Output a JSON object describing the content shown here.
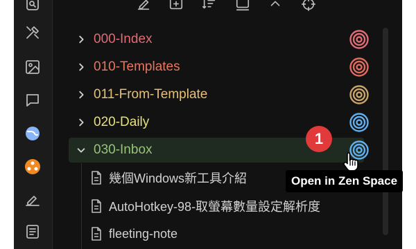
{
  "colors": {
    "index": "#e06c75",
    "templates": "#e8765f",
    "from_template": "#e5c07b",
    "daily": "#e6e17a",
    "inbox": "#98c379",
    "target_index": "#e06c75",
    "target_templates": "#e06c60",
    "target_from_template": "#c9a56a",
    "target_daily": "#61afef",
    "target_inbox": "#61afef",
    "badge": "#e03a3a"
  },
  "folders": [
    {
      "label": "000-Index",
      "expanded": false
    },
    {
      "label": "010-Templates",
      "expanded": false
    },
    {
      "label": "011-From-Template",
      "expanded": false
    },
    {
      "label": "020-Daily",
      "expanded": false
    },
    {
      "label": "030-Inbox",
      "expanded": true
    }
  ],
  "files": [
    {
      "label": "幾個Windows新工具介紹"
    },
    {
      "label": "AutoHotkey-98-取螢幕數量設定解析度"
    },
    {
      "label": "fleeting-note"
    }
  ],
  "badge": {
    "text": "1"
  },
  "tooltip": {
    "text": "Open in Zen Space"
  },
  "icons": {
    "ribbon": [
      "search-icon",
      "tools-icon",
      "image-icon",
      "chat-icon",
      "globe-icon",
      "graph-icon",
      "signature-icon",
      "book-icon"
    ],
    "toolbar": [
      "new-note-icon",
      "new-folder-icon",
      "sort-icon",
      "collapse-icon",
      "chevron-up-icon",
      "target-icon"
    ]
  }
}
